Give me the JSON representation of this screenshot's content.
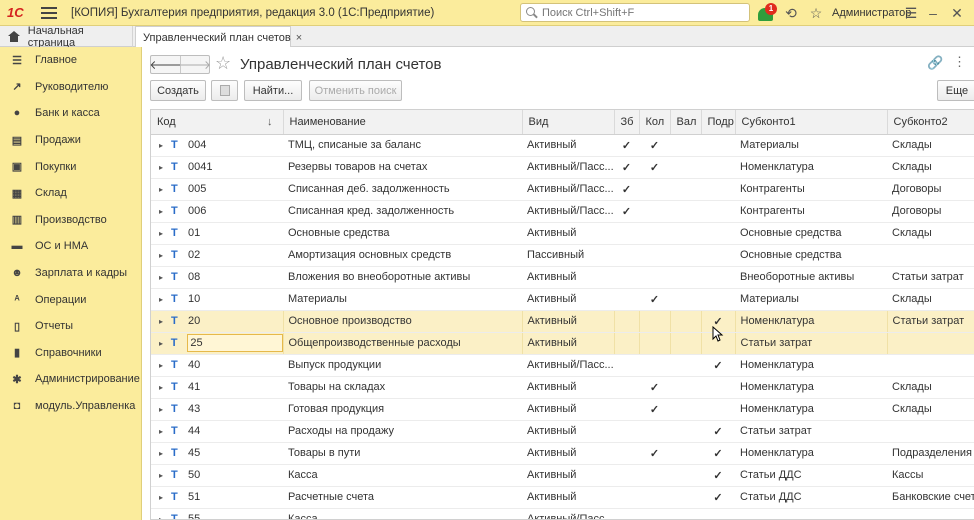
{
  "titlebar": {
    "logo": "1С",
    "title": "[КОПИЯ] Бухгалтерия предприятия, редакция 3.0  (1С:Предприятие)",
    "search_placeholder": "Поиск Ctrl+Shift+F",
    "notification_count": "1",
    "user": "Администратор"
  },
  "tabs": {
    "home": "Начальная страница",
    "active": "Управленческий план счетов",
    "close": "×"
  },
  "sidebar": {
    "items": [
      {
        "label": "Главное",
        "icon": "list-icon",
        "glyph": "☰"
      },
      {
        "label": "Руководителю",
        "icon": "trend-icon",
        "glyph": "↗"
      },
      {
        "label": "Банк и касса",
        "icon": "coin-icon",
        "glyph": "●"
      },
      {
        "label": "Продажи",
        "icon": "sales-icon",
        "glyph": "▤"
      },
      {
        "label": "Покупки",
        "icon": "cart-icon",
        "glyph": "▣"
      },
      {
        "label": "Склад",
        "icon": "warehouse-icon",
        "glyph": "▦"
      },
      {
        "label": "Производство",
        "icon": "factory-icon",
        "glyph": "▥"
      },
      {
        "label": "ОС и НМА",
        "icon": "truck-icon",
        "glyph": "▬"
      },
      {
        "label": "Зарплата и кадры",
        "icon": "people-icon",
        "glyph": "☻"
      },
      {
        "label": "Операции",
        "icon": "operations-icon",
        "glyph": "ᴬ"
      },
      {
        "label": "Отчеты",
        "icon": "reports-icon",
        "glyph": "▯"
      },
      {
        "label": "Справочники",
        "icon": "book-icon",
        "glyph": "▮"
      },
      {
        "label": "Администрирование",
        "icon": "gear-icon",
        "glyph": "✱"
      },
      {
        "label": "модуль.Управленка",
        "icon": "module-icon",
        "glyph": "◘"
      }
    ]
  },
  "form": {
    "title": "Управленческий план счетов",
    "toolbar": {
      "create": "Создать",
      "find": "Найти...",
      "cancel_search": "Отменить поиск",
      "more": "Еще"
    }
  },
  "table": {
    "columns": [
      "Код",
      "Наименование",
      "Вид",
      "Зб",
      "Кол",
      "Вал",
      "Подр",
      "Субконто1",
      "Субконто2"
    ],
    "rows": [
      {
        "code": "004",
        "name": "ТМЦ, списаные за баланс",
        "kind": "Активный",
        "zb": true,
        "kol": true,
        "val": false,
        "podr": false,
        "sub1": "Материалы",
        "sub2": "Склады"
      },
      {
        "code": "0041",
        "name": "Резервы товаров на счетах",
        "kind": "Активный/Пасс...",
        "zb": true,
        "kol": true,
        "val": false,
        "podr": false,
        "sub1": "Номенклатура",
        "sub2": "Склады"
      },
      {
        "code": "005",
        "name": "Списанная деб. задолженность",
        "kind": "Активный/Пасс...",
        "zb": true,
        "kol": false,
        "val": false,
        "podr": false,
        "sub1": "Контрагенты",
        "sub2": "Договоры"
      },
      {
        "code": "006",
        "name": "Списанная кред. задолженность",
        "kind": "Активный/Пасс...",
        "zb": true,
        "kol": false,
        "val": false,
        "podr": false,
        "sub1": "Контрагенты",
        "sub2": "Договоры"
      },
      {
        "code": "01",
        "name": "Основные средства",
        "kind": "Активный",
        "zb": false,
        "kol": false,
        "val": false,
        "podr": false,
        "sub1": "Основные средства",
        "sub2": "Склады"
      },
      {
        "code": "02",
        "name": "Амортизация основных средств",
        "kind": "Пассивный",
        "zb": false,
        "kol": false,
        "val": false,
        "podr": false,
        "sub1": "Основные средства",
        "sub2": ""
      },
      {
        "code": "08",
        "name": "Вложения во внеоборотные активы",
        "kind": "Активный",
        "zb": false,
        "kol": false,
        "val": false,
        "podr": false,
        "sub1": "Внеоборотные активы",
        "sub2": "Статьи затрат"
      },
      {
        "code": "10",
        "name": "Материалы",
        "kind": "Активный",
        "zb": false,
        "kol": true,
        "val": false,
        "podr": false,
        "sub1": "Материалы",
        "sub2": "Склады"
      },
      {
        "code": "20",
        "name": "Основное производство",
        "kind": "Активный",
        "zb": false,
        "kol": false,
        "val": false,
        "podr": true,
        "sub1": "Номенклатура",
        "sub2": "Статьи затрат",
        "highlight": true
      },
      {
        "code": "25",
        "name": "Общепроизводственные расходы",
        "kind": "Активный",
        "zb": false,
        "kol": false,
        "val": false,
        "podr": false,
        "sub1": "Статьи затрат",
        "sub2": "",
        "highlight": true,
        "selected": true
      },
      {
        "code": "40",
        "name": "Выпуск продукции",
        "kind": "Активный/Пасс...",
        "zb": false,
        "kol": false,
        "val": false,
        "podr": true,
        "sub1": "Номенклатура",
        "sub2": ""
      },
      {
        "code": "41",
        "name": "Товары на складах",
        "kind": "Активный",
        "zb": false,
        "kol": true,
        "val": false,
        "podr": false,
        "sub1": "Номенклатура",
        "sub2": "Склады"
      },
      {
        "code": "43",
        "name": "Готовая продукция",
        "kind": "Активный",
        "zb": false,
        "kol": true,
        "val": false,
        "podr": false,
        "sub1": "Номенклатура",
        "sub2": "Склады"
      },
      {
        "code": "44",
        "name": "Расходы на продажу",
        "kind": "Активный",
        "zb": false,
        "kol": false,
        "val": false,
        "podr": true,
        "sub1": "Статьи затрат",
        "sub2": ""
      },
      {
        "code": "45",
        "name": "Товары в пути",
        "kind": "Активный",
        "zb": false,
        "kol": true,
        "val": false,
        "podr": true,
        "sub1": "Номенклатура",
        "sub2": "Подразделения"
      },
      {
        "code": "50",
        "name": "Касса",
        "kind": "Активный",
        "zb": false,
        "kol": false,
        "val": false,
        "podr": true,
        "sub1": "Статьи ДДС",
        "sub2": "Кассы"
      },
      {
        "code": "51",
        "name": "Расчетные счета",
        "kind": "Активный",
        "zb": false,
        "kol": false,
        "val": false,
        "podr": true,
        "sub1": "Статьи ДДС",
        "sub2": "Банковские счета"
      },
      {
        "code": "55",
        "name": "Касса",
        "kind": "Активный/Пасс...",
        "zb": false,
        "kol": false,
        "val": false,
        "podr": false,
        "sub1": "",
        "sub2": ""
      }
    ],
    "tree_marker": "Т",
    "expand_glyph": "▸",
    "check_glyph": "✓",
    "sort_glyph": "↓"
  },
  "colors": {
    "brand_yellow": "#fbec9c",
    "check_green": "#2e9d3c",
    "highlight_row": "#fbf0c6",
    "tree_blue": "#2a6cc8"
  }
}
